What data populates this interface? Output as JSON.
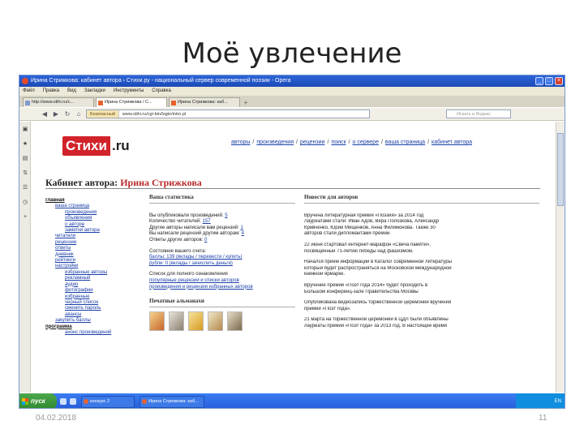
{
  "slide": {
    "title": "Моё увлечение",
    "date": "04.02.2018",
    "page_number": "11"
  },
  "window": {
    "title": "Ирина Стрижкова: кабинет автора › Стихи.ру - национальный сервер современной поэзии - Opera",
    "controls": {
      "minimize": "_",
      "maximize": "□",
      "close": "×"
    }
  },
  "menu": [
    "Файл",
    "Правка",
    "Вид",
    "Закладки",
    "Инструменты",
    "Справка"
  ],
  "tabs": [
    {
      "label": "http://www.stihi.ru/c...",
      "active": false
    },
    {
      "label": "Ирина Стрижкова / С...",
      "active": true
    },
    {
      "label": "Ирина Стрижкова: каб...",
      "active": false
    }
  ],
  "navbar": {
    "badge": "Безопасный",
    "url": "www.stihi.ru/cgi-bin/login/intro.pl",
    "search_placeholder": "Искать в Яндекс"
  },
  "site": {
    "logo_main": "Стихи",
    "logo_suffix": ".ru",
    "topnav": [
      "авторы",
      "произведения",
      "рецензии",
      "поиск",
      "о сервере",
      "ваша страница",
      "кабинет автора"
    ],
    "cabinet_label": "Кабинет автора:",
    "author_name": "Ирина Стрижкова"
  },
  "sidebar": [
    {
      "label": "главная",
      "level": 0
    },
    {
      "label": "ваша страница",
      "level": 1
    },
    {
      "label": "произведения",
      "level": 2
    },
    {
      "label": "объявления",
      "level": 2
    },
    {
      "label": "о авторе",
      "level": 2
    },
    {
      "label": "заметки автора",
      "level": 2
    },
    {
      "label": "читатели",
      "level": 1
    },
    {
      "label": "рецензии",
      "level": 1
    },
    {
      "label": "ответы",
      "level": 1
    },
    {
      "label": "дневник",
      "level": 1
    },
    {
      "label": "рейтинги",
      "level": 1
    },
    {
      "label": "настройки",
      "level": 1
    },
    {
      "label": "избранные авторы",
      "level": 2
    },
    {
      "label": "рекламный",
      "level": 2
    },
    {
      "label": "аудио",
      "level": 2
    },
    {
      "label": "фотографии",
      "level": 2
    },
    {
      "label": "избранные",
      "level": 2
    },
    {
      "label": "черный список",
      "level": 2
    },
    {
      "label": "сменить пароль",
      "level": 2
    },
    {
      "label": "авансы",
      "level": 2
    },
    {
      "label": "закупить баллы",
      "level": 1
    },
    {
      "label": "программа",
      "level": 0
    },
    {
      "label": "анонс произведений",
      "level": 2
    }
  ],
  "stats": {
    "heading": "Ваша статистика",
    "lines": [
      {
        "text": "Вы опубликовали произведений:",
        "value": "5"
      },
      {
        "text": "Количество читателей:",
        "value": "157"
      },
      {
        "text": "Другие авторы написали вам рецензий:",
        "value": "1"
      },
      {
        "text": "Вы написали рецензий другим авторам:",
        "value": "4"
      },
      {
        "text": "Ответы других авторов:",
        "value": "0"
      }
    ],
    "balance_head": "Состояние вашего счета:",
    "balance_line1": "баллы: 139 (вклады / перевести / купить)",
    "balance_line2": "рубли: 0 (вклады / зачислить деньги)",
    "offer_line1": "Список для полного ознакомления",
    "offer_line2": "популярные рецензии и списки авторов",
    "offer_line3": "произведения и рецензии избранных авторов",
    "albums_head": "Печатные альманахи"
  },
  "news": {
    "heading": "Новости для авторов",
    "items": [
      "Вручена литературная премия «Поэзия» за 2014 год",
      "Лауреатами стали: Иван Адов, Вера Полозкова, Александр",
      "Кривченко, Юрий Мищенков, Анна Филимонова. Также 30",
      "авторов стали дипломантами премии.",
      "22 июня стартовал интернет-марафон «Свеча памяти»,",
      "посвященный 71-летию победы над фашизмом.",
      "Начался прием информации в Каталог современной литературы",
      "который будет распространяться на Московской международной",
      "книжной ярмарке.",
      "Вручение премии «Поэт года 2014» будет проходить в",
      "Большом конференц-зале Правительства Москвы",
      "Опубликована видеозапись торжественной церемонии вручения",
      "премии «Поэт года».",
      "21 марта на торжественной церемонии в ЦДЛ были объявлены",
      "лауреаты премии «Поэт года» за 2013 год. В настоящее время"
    ]
  },
  "taskbar": {
    "start": "пуск",
    "items": [
      "конкурс 2",
      "Ирина Стрижкова: каб..."
    ],
    "tray": "EN"
  }
}
